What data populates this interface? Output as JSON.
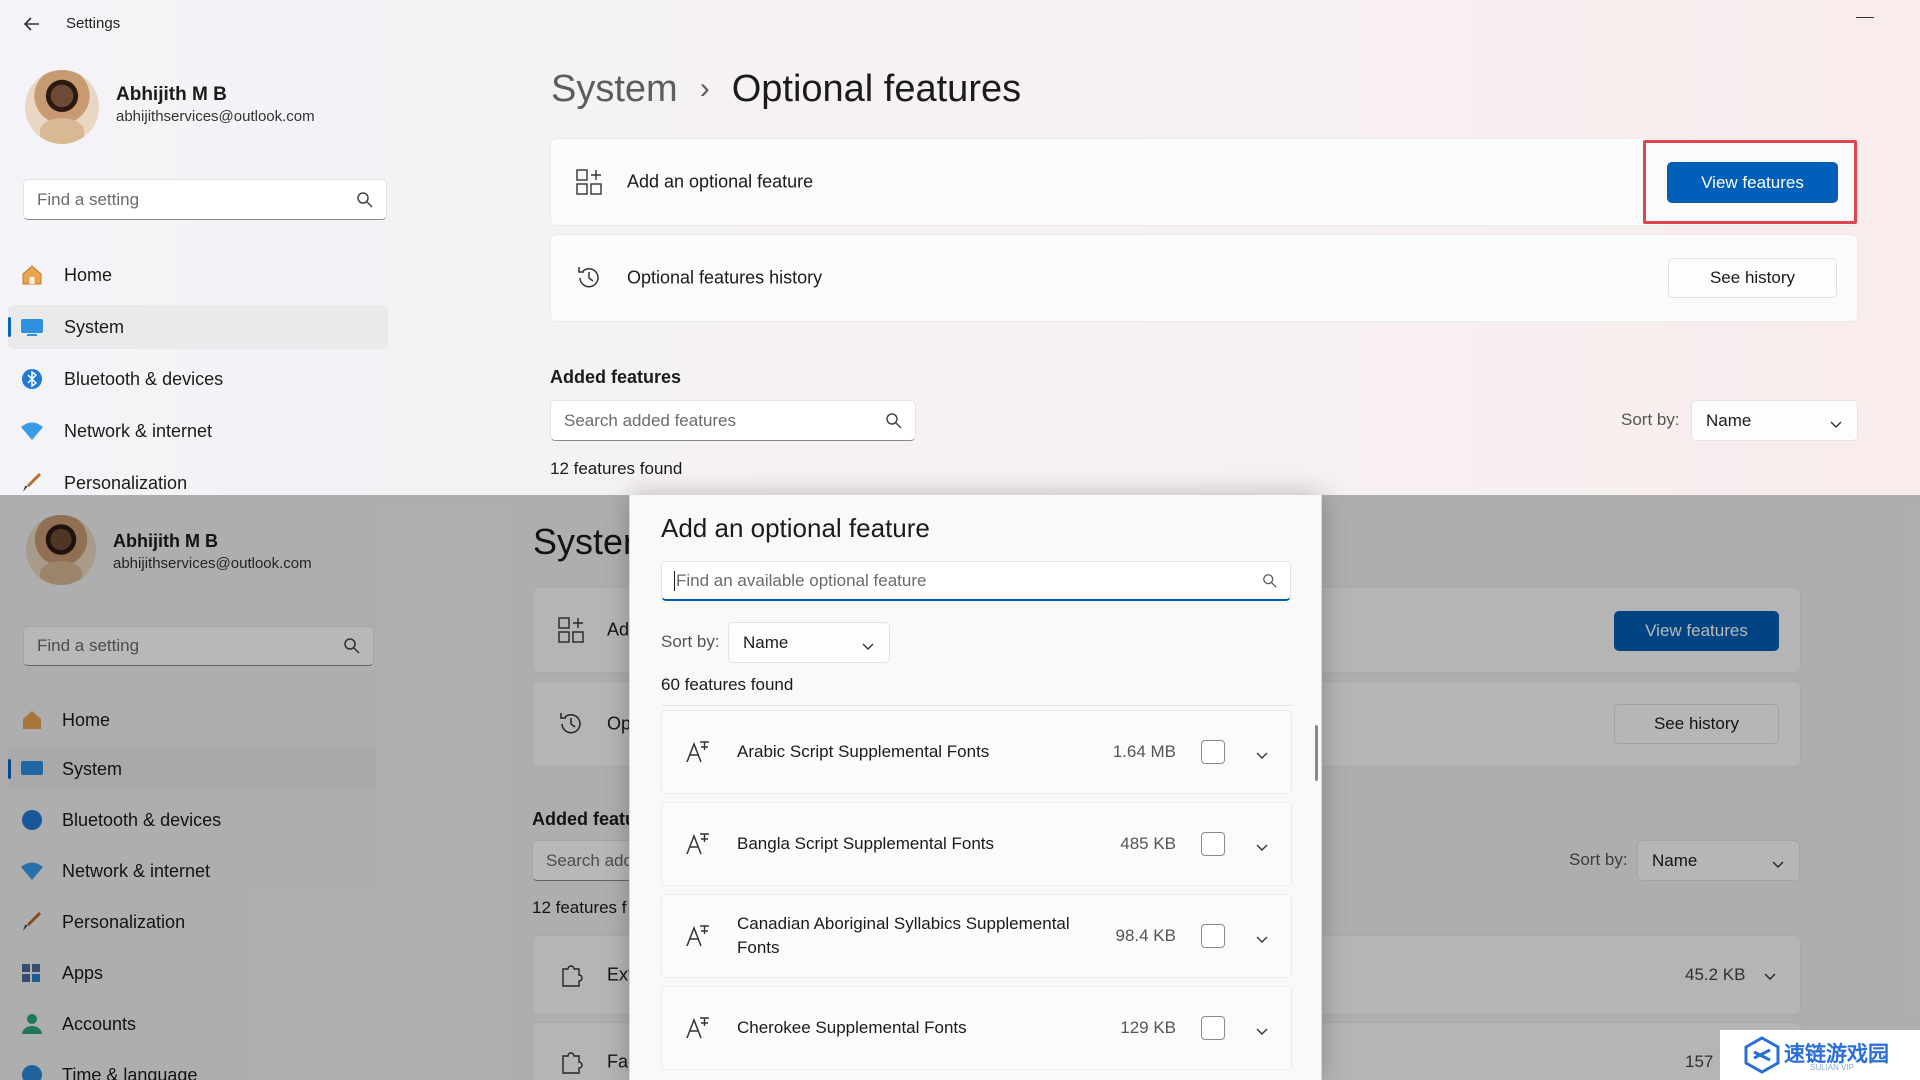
{
  "window": {
    "app_title": "Settings"
  },
  "profile": {
    "name": "Abhijith M B",
    "email": "abhijithservices@outlook.com"
  },
  "search": {
    "placeholder": "Find a setting"
  },
  "nav": {
    "items": [
      {
        "label": "Home",
        "icon": "home-icon"
      },
      {
        "label": "System",
        "icon": "system-icon",
        "active": true
      },
      {
        "label": "Bluetooth & devices",
        "icon": "bluetooth-icon"
      },
      {
        "label": "Network & internet",
        "icon": "wifi-icon"
      },
      {
        "label": "Personalization",
        "icon": "brush-icon"
      },
      {
        "label": "Apps",
        "icon": "apps-icon"
      },
      {
        "label": "Accounts",
        "icon": "accounts-icon"
      },
      {
        "label": "Time & language",
        "icon": "globe-icon"
      }
    ]
  },
  "breadcrumb": {
    "parent": "System",
    "separator": "›",
    "current": "Optional features"
  },
  "cards": {
    "add_feature": {
      "label": "Add an optional feature",
      "button": "View features"
    },
    "history": {
      "label": "Optional features history",
      "button": "See history"
    }
  },
  "added_features": {
    "title": "Added features",
    "search_placeholder": "Search added features",
    "count_text": "12 features found",
    "sort_label": "Sort by:",
    "sort_value": "Name"
  },
  "background_window": {
    "title_partial": "Syster",
    "add_label_partial": "Ad",
    "history_label_partial": "Op",
    "added_features_partial": "Added featu",
    "search_partial": "Search add",
    "count_partial": "12 features f",
    "rows": [
      {
        "label_partial": "Ext",
        "size": "45.2 KB"
      },
      {
        "label_partial": "Fac",
        "size": "157"
      }
    ]
  },
  "dialog": {
    "title": "Add an optional feature",
    "search_placeholder": "Find an available optional feature",
    "sort_label": "Sort by:",
    "sort_value": "Name",
    "count_text": "60 features found",
    "features": [
      {
        "name": "Arabic Script Supplemental Fonts",
        "size": "1.64 MB",
        "checked": false
      },
      {
        "name": "Bangla Script Supplemental Fonts",
        "size": "485 KB",
        "checked": false
      },
      {
        "name": "Canadian Aboriginal Syllabics Supplemental Fonts",
        "size": "98.4 KB",
        "checked": false
      },
      {
        "name": "Cherokee Supplemental Fonts",
        "size": "129 KB",
        "checked": false
      }
    ]
  },
  "watermark": {
    "text": "速链游戏园",
    "sub": "SULIAN VIP"
  },
  "colors": {
    "accent": "#005fb8",
    "highlight": "#e0464e",
    "nav_indicator": "#0067c0"
  }
}
